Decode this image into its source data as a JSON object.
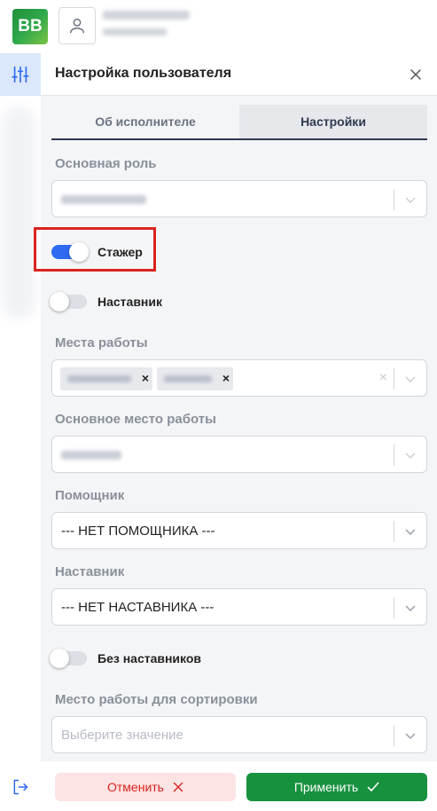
{
  "app": {
    "logo_text": "BB",
    "brand_color": "#2fa84b"
  },
  "panel": {
    "title": "Настройка пользователя",
    "tabs": [
      {
        "label": "Об исполнителе",
        "active": false
      },
      {
        "label": "Настройки",
        "active": true
      }
    ]
  },
  "form": {
    "main_role": {
      "label": "Основная роль"
    },
    "trainee_toggle": {
      "label": "Стажер",
      "on": true
    },
    "mentor_toggle": {
      "label": "Наставник",
      "on": false
    },
    "workplaces": {
      "label": "Места работы"
    },
    "main_workplace": {
      "label": "Основное место работы"
    },
    "assistant": {
      "label": "Помощник",
      "value": "--- НЕТ ПОМОЩНИКА ---"
    },
    "mentor_select": {
      "label": "Наставник",
      "value": "--- НЕТ НАСТАВНИКА ---"
    },
    "no_mentors_toggle": {
      "label": "Без наставников",
      "on": false
    },
    "sort_workplace": {
      "label": "Место работы для сортировки",
      "placeholder": "Выберите значение"
    }
  },
  "footer": {
    "cancel_label": "Отменить",
    "apply_label": "Применить"
  },
  "colors": {
    "accent": "#2f6bf0",
    "cancel": "#d9231f",
    "apply": "#18913f",
    "highlight": "#d9231f"
  }
}
